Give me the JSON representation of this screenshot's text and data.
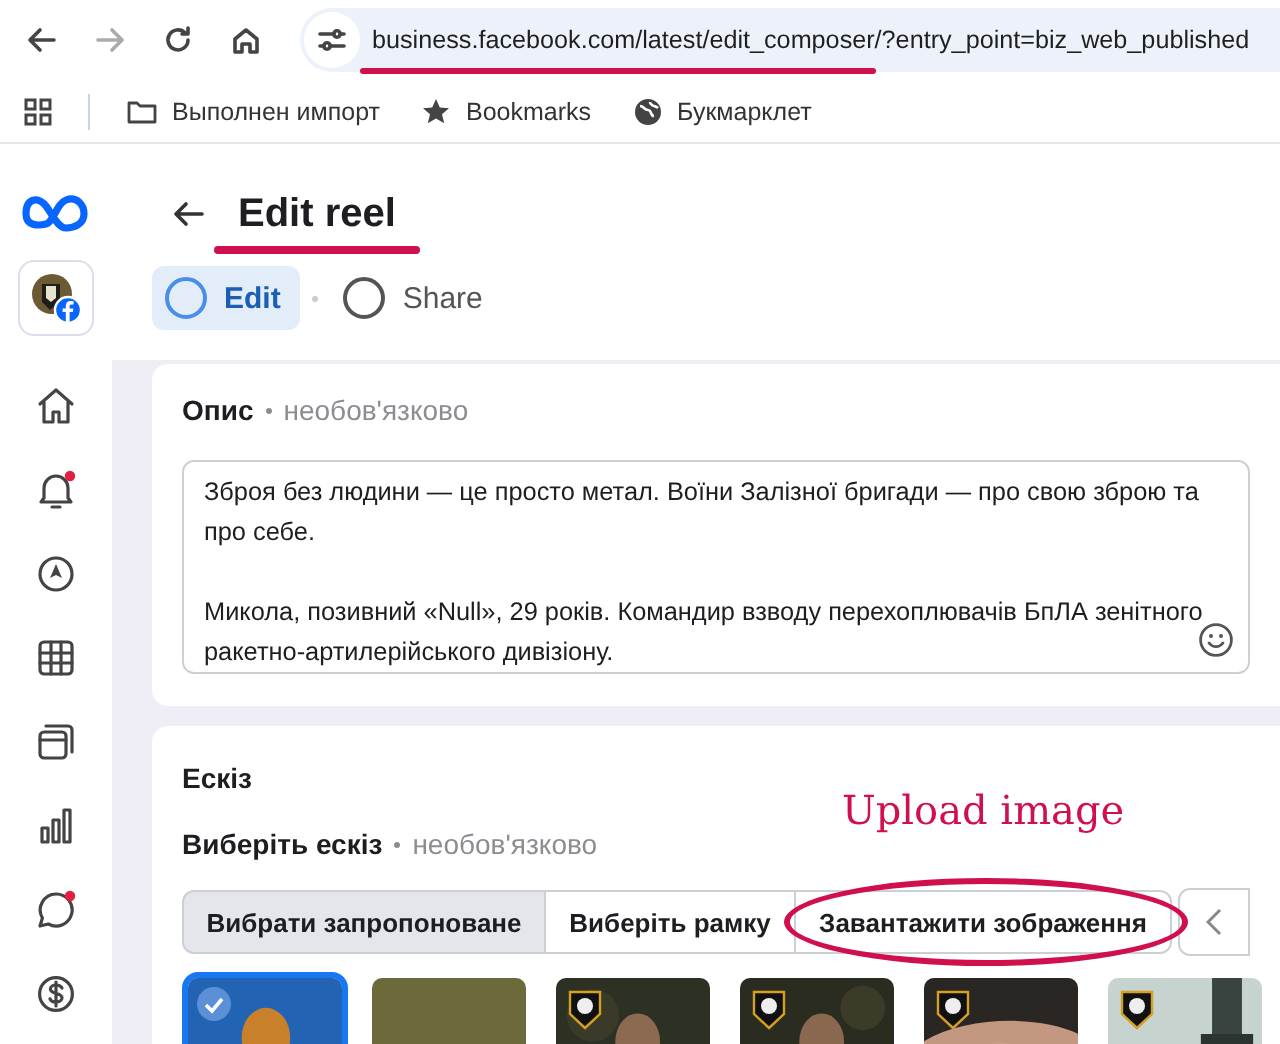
{
  "browser": {
    "address": "business.facebook.com/latest/edit_composer/?entry_point=biz_web_published",
    "bookmarks": [
      {
        "kind": "folder",
        "label": "Выполнен импорт"
      },
      {
        "kind": "star",
        "label": "Bookmarks"
      },
      {
        "kind": "globe",
        "label": "Букмарклет"
      }
    ]
  },
  "sidebar": {
    "items": [
      {
        "kind": "home",
        "notification": false
      },
      {
        "kind": "bell",
        "notification": true
      },
      {
        "kind": "compass",
        "notification": false
      },
      {
        "kind": "table",
        "notification": false
      },
      {
        "kind": "layers",
        "notification": false
      },
      {
        "kind": "chart",
        "notification": false
      },
      {
        "kind": "chat",
        "notification": true
      },
      {
        "kind": "money",
        "notification": false
      }
    ]
  },
  "header": {
    "title": "Edit reel",
    "steps": [
      {
        "label": "Edit",
        "selected": true
      },
      {
        "label": "Share",
        "selected": false
      }
    ]
  },
  "description": {
    "label": "Опис",
    "hint": "необов'язково",
    "value": "Зброя без людини — це просто метал. Воїни Залізної бригади — про свою зброю та про себе.\n\nМикола, позивний «Null», 29 років. Командир взводу перехоплювачів БпЛА зенітного ракетно-артилерійського дивізіону."
  },
  "thumbnail": {
    "title": "Ескіз",
    "label": "Виберіть ескіз",
    "hint": "необов'язково",
    "annotation": "Upload image",
    "tabs": [
      {
        "label": "Вибрати запропоноване",
        "selected": true
      },
      {
        "label": "Виберіть рамку",
        "selected": false
      },
      {
        "label": "Завантажити зображення",
        "selected": false
      }
    ],
    "options": [
      {
        "selected": true,
        "badge": false
      },
      {
        "selected": false,
        "badge": false
      },
      {
        "selected": false,
        "badge": true
      },
      {
        "selected": false,
        "badge": true
      },
      {
        "selected": false,
        "badge": true
      },
      {
        "selected": false,
        "badge": true
      }
    ]
  }
}
